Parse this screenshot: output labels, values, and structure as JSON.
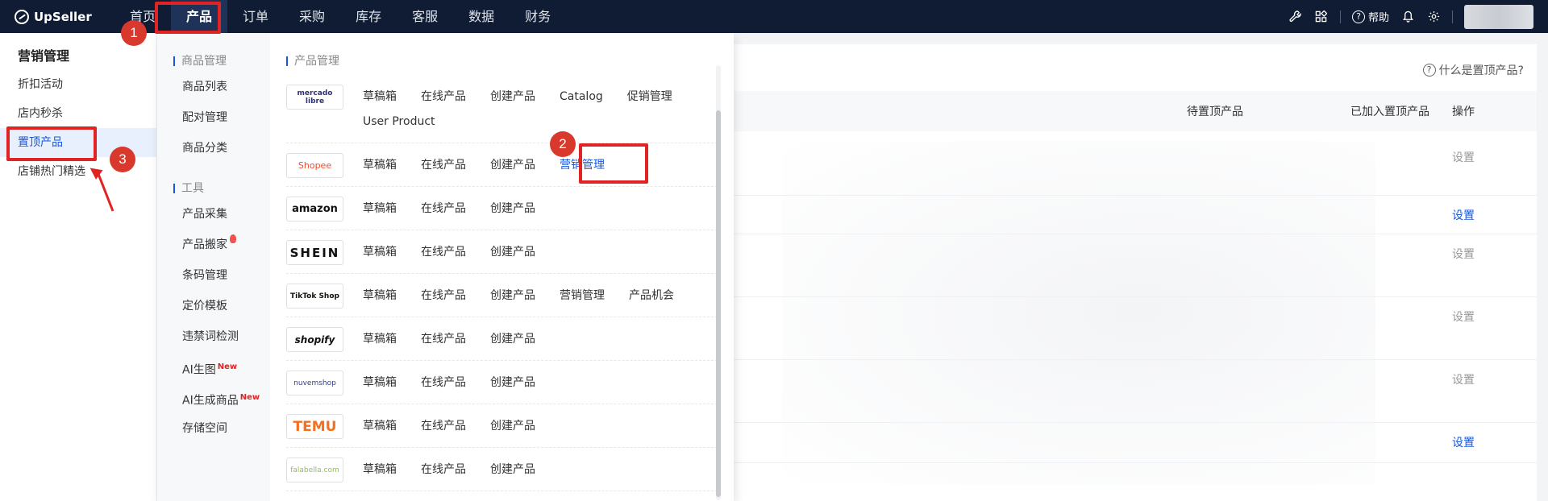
{
  "app": {
    "brand": "UpSeller"
  },
  "topnav": {
    "items": [
      "首页",
      "产品",
      "订单",
      "采购",
      "库存",
      "客服",
      "数据",
      "财务"
    ],
    "active_index": 1,
    "help_label": "帮助",
    "icons": [
      "tool-icon",
      "apps-icon",
      "help-icon",
      "bell-icon",
      "gear-icon"
    ]
  },
  "sidebar": {
    "title": "营销管理",
    "items": [
      "折扣活动",
      "店内秒杀",
      "置顶产品",
      "店铺热门精选"
    ],
    "active_index": 2
  },
  "main": {
    "help_link": "什么是置顶产品?",
    "columns": {
      "pending": "待置顶产品",
      "added": "已加入置顶产品",
      "ops": "操作"
    },
    "rows": [
      {
        "action": "设置",
        "enabled": false
      },
      {
        "action": "设置",
        "enabled": true
      },
      {
        "action": "设置",
        "enabled": false
      },
      {
        "action": "设置",
        "enabled": false
      },
      {
        "action": "设置",
        "enabled": false
      },
      {
        "action": "设置",
        "enabled": true
      }
    ]
  },
  "dropdown": {
    "left": {
      "group1_title": "商品管理",
      "group1_items": [
        "商品列表",
        "配对管理",
        "商品分类"
      ],
      "group2_title": "工具",
      "group2_items": [
        "产品采集",
        "产品搬家",
        "条码管理",
        "定价模板",
        "违禁词检测",
        "AI生图",
        "AI生成商品",
        "存储空间"
      ],
      "new_badge": "New"
    },
    "right": {
      "title": "产品管理",
      "platforms": [
        {
          "logo": "mercado libre",
          "links": [
            "草稿箱",
            "在线产品",
            "创建产品",
            "Catalog",
            "促销管理",
            "User Product"
          ]
        },
        {
          "logo": "Shopee",
          "links": [
            "草稿箱",
            "在线产品",
            "创建产品",
            "营销管理"
          ]
        },
        {
          "logo": "amazon",
          "links": [
            "草稿箱",
            "在线产品",
            "创建产品"
          ]
        },
        {
          "logo": "SHEIN",
          "links": [
            "草稿箱",
            "在线产品",
            "创建产品"
          ]
        },
        {
          "logo": "TikTok Shop",
          "links": [
            "草稿箱",
            "在线产品",
            "创建产品",
            "营销管理",
            "产品机会"
          ]
        },
        {
          "logo": "shopify",
          "links": [
            "草稿箱",
            "在线产品",
            "创建产品"
          ]
        },
        {
          "logo": "nuvemshop",
          "links": [
            "草稿箱",
            "在线产品",
            "创建产品"
          ]
        },
        {
          "logo": "TEMU",
          "links": [
            "草稿箱",
            "在线产品",
            "创建产品"
          ]
        },
        {
          "logo": "falabella.com",
          "links": [
            "草稿箱",
            "在线产品",
            "创建产品"
          ]
        }
      ]
    }
  },
  "annotations": {
    "step1": "1",
    "step2": "2",
    "step3": "3"
  },
  "colors": {
    "topbar": "#0f1c33",
    "accent": "#1a56db",
    "annotation": "#e02424"
  }
}
